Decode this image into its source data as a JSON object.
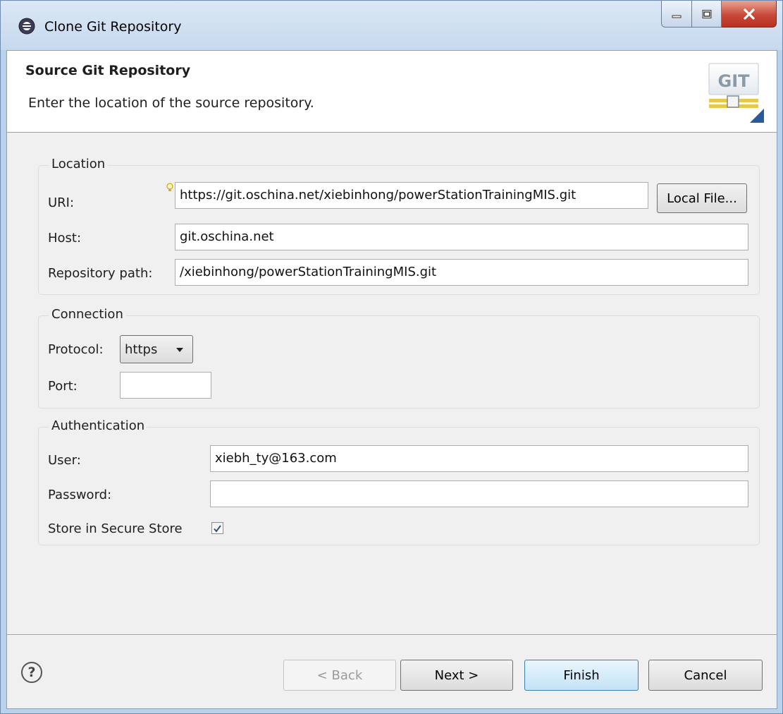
{
  "window": {
    "title": "Clone Git Repository"
  },
  "header": {
    "title": "Source Git Repository",
    "description": "Enter the location of the source repository.",
    "logo_text": "GIT"
  },
  "location": {
    "legend": "Location",
    "uri_label": "URI:",
    "uri_value": "https://git.oschina.net/xiebinhong/powerStationTrainingMIS.git",
    "local_file_label": "Local File...",
    "host_label": "Host:",
    "host_value": "git.oschina.net",
    "path_label": "Repository path:",
    "path_value": "/xiebinhong/powerStationTrainingMIS.git"
  },
  "connection": {
    "legend": "Connection",
    "protocol_label": "Protocol:",
    "protocol_value": "https",
    "port_label": "Port:",
    "port_value": ""
  },
  "authentication": {
    "legend": "Authentication",
    "user_label": "User:",
    "user_value": "xiebh_ty@163.com",
    "password_label": "Password:",
    "password_value": "",
    "store_label": "Store in Secure Store",
    "store_checked": true
  },
  "footer": {
    "back_label": "< Back",
    "next_label": "Next >",
    "finish_label": "Finish",
    "cancel_label": "Cancel"
  },
  "icons": {
    "app": "eclipse-icon",
    "minimize": "minimize-icon",
    "maximize": "maximize-icon",
    "close": "close-icon",
    "help": "help-icon",
    "hint": "lightbulb-icon",
    "logo": "git-logo-icon",
    "dropdown": "chevron-down-icon",
    "check": "checkmark-icon"
  }
}
